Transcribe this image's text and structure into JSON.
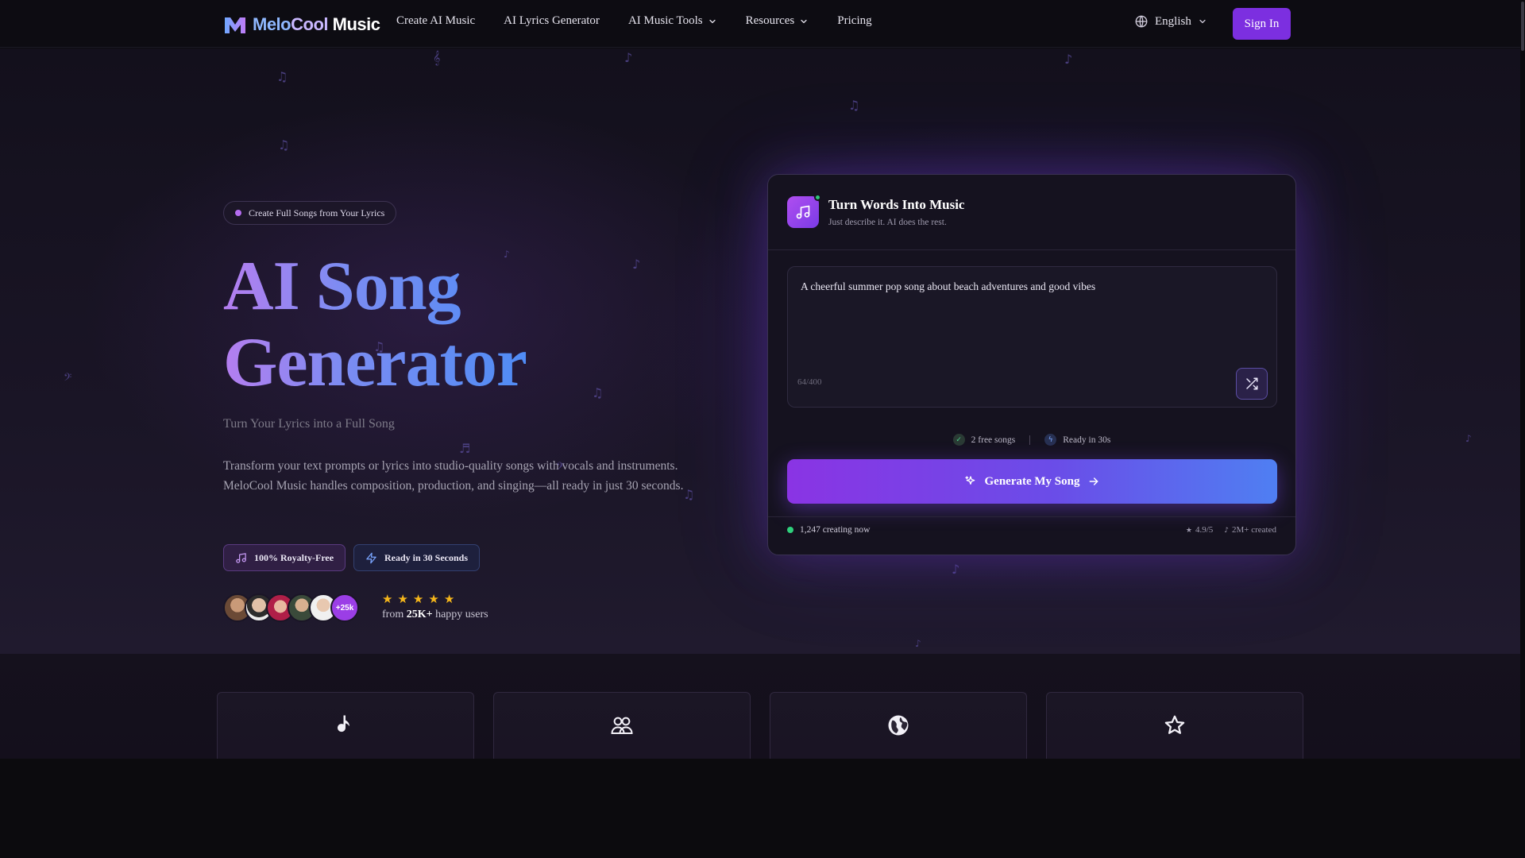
{
  "brand": {
    "name_part1": "Melo",
    "name_part2": "Cool",
    "name_part3": " Music"
  },
  "nav": {
    "items": [
      {
        "label": "Create AI Music",
        "dropdown": false
      },
      {
        "label": "AI Lyrics Generator",
        "dropdown": false
      },
      {
        "label": "AI Music Tools",
        "dropdown": true
      },
      {
        "label": "Resources",
        "dropdown": true
      },
      {
        "label": "Pricing",
        "dropdown": false
      }
    ],
    "language": "English",
    "signin_label": "Sign In"
  },
  "hero": {
    "badge": "Create Full Songs from Your Lyrics",
    "title_line1": "AI Song",
    "title_line2": "Generator",
    "subtitle": "Turn Your Lyrics into a Full Song",
    "description": "Transform your text prompts or lyrics into studio-quality songs with vocals and instruments. MeloCool Music handles composition, production, and singing—all ready in just 30 seconds.",
    "feature_royalty": "100% Royalty-Free",
    "feature_ready": "Ready in 30 Seconds",
    "avatar_more": "+25k",
    "rating_stars": 5,
    "happy_prefix": "from ",
    "happy_count": "25K+",
    "happy_suffix": " happy users"
  },
  "card": {
    "title": "Turn Words Into Music",
    "subtitle": "Just describe it. AI does the rest.",
    "prompt_value": "A cheerful summer pop song about beach adventures and good vibes",
    "char_count": "64/400",
    "free_songs": "2 free songs",
    "ready_time": "Ready in 30s",
    "generate_label": "Generate My Song",
    "creating_now": "1,247 creating now",
    "rating": "4.9/5",
    "created": "2M+ created"
  },
  "features": [
    {
      "icon": "music-note-icon"
    },
    {
      "icon": "users-icon"
    },
    {
      "icon": "globe-icon"
    },
    {
      "icon": "star-icon"
    }
  ],
  "colors": {
    "accent": "#7c2fe0",
    "gradient_start": "#8a34e4",
    "gradient_end": "#4f7ff2",
    "star": "#f5b61b",
    "online": "#2fd07c"
  }
}
